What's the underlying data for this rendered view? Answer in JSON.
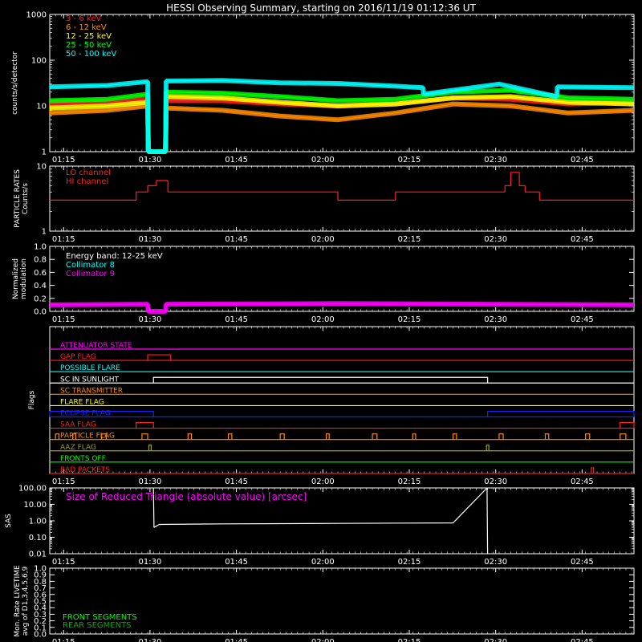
{
  "title": "HESSI Observing Summary, starting on 2016/11/19 01:12:36 UT",
  "time_axis": {
    "labels": [
      "01:15",
      "01:30",
      "01:45",
      "02:00",
      "02:15",
      "02:30",
      "02:45"
    ],
    "minutes": [
      2.4,
      17.4,
      32.4,
      47.4,
      62.4,
      77.4,
      92.4
    ],
    "range_min": [
      0,
      101.4
    ]
  },
  "colors": {
    "red": "#ff2020",
    "orange": "#ff8c00",
    "yellow": "#ffff00",
    "green": "#00ff00",
    "cyan": "#00ffff",
    "magenta": "#ff00ff",
    "white": "#ffffff",
    "blue": "#2020ff",
    "olive": "#a0a020",
    "dkgreen": "#00b000"
  },
  "chart_data": [
    {
      "type": "line",
      "ylabel": "counts/s/detector",
      "yscale": "log",
      "ylim": [
        1,
        1000
      ],
      "yticks": [
        "1",
        "10",
        "100",
        "1000"
      ],
      "yticks_values": [
        1,
        10,
        100,
        1000
      ],
      "legend_position": "top-left",
      "series": [
        {
          "name": "3 - 6 keV",
          "color": "#ff2020",
          "x": [
            0,
            10,
            17,
            17.1,
            20.1,
            20.2,
            30,
            40,
            50,
            60,
            70,
            80,
            90,
            101.4
          ],
          "y": [
            11,
            12,
            14,
            1,
            1,
            13,
            13,
            11,
            10,
            11,
            15,
            14,
            11,
            12
          ]
        },
        {
          "name": "6 - 12 keV",
          "color": "#ff8c00",
          "x": [
            0,
            10,
            17,
            17.1,
            20.1,
            20.2,
            30,
            40,
            50,
            60,
            70,
            80,
            90,
            101.4
          ],
          "y": [
            7,
            8,
            10,
            1,
            1,
            9,
            8,
            6,
            5,
            7,
            11,
            10,
            7,
            8
          ]
        },
        {
          "name": "12 - 25 keV",
          "color": "#ffff00",
          "x": [
            0,
            10,
            17,
            17.1,
            20.1,
            20.2,
            30,
            40,
            50,
            60,
            70,
            80,
            90,
            101.4
          ],
          "y": [
            9,
            10,
            12,
            1,
            1,
            16,
            15,
            12,
            10,
            11,
            15,
            16,
            12,
            11
          ]
        },
        {
          "name": "25 - 50 keV",
          "color": "#00ff00",
          "x": [
            0,
            10,
            17,
            17.1,
            20.1,
            20.2,
            30,
            40,
            50,
            60,
            70,
            80,
            90,
            101.4
          ],
          "y": [
            13,
            14,
            18,
            1,
            1,
            20,
            19,
            16,
            13,
            14,
            20,
            22,
            15,
            14
          ]
        },
        {
          "name": "50 - 100 keV",
          "color": "#00ffff",
          "x": [
            0,
            10,
            17,
            17.1,
            20.1,
            20.2,
            30,
            40,
            50,
            60,
            64.8,
            64.9,
            78,
            88,
            88.1,
            101.4
          ],
          "y": [
            26,
            28,
            34,
            1,
            1,
            35,
            36,
            32,
            31,
            27,
            25,
            18,
            30,
            16,
            26,
            25
          ]
        }
      ]
    },
    {
      "type": "line",
      "ylabel": "PARTICLE RATES\nCounts/s",
      "yscale": "log",
      "ylim": [
        1,
        10
      ],
      "yticks": [
        "1",
        "10"
      ],
      "yticks_values": [
        1,
        10
      ],
      "legend_position": "top-left",
      "series": [
        {
          "name": "LO channel",
          "color": "#ff2020",
          "x": [
            0,
            10,
            15,
            17,
            18.5,
            20.5,
            30,
            40,
            50,
            60,
            70,
            75,
            79,
            80,
            81.5,
            82.5,
            85,
            101.4
          ],
          "y": [
            3,
            3,
            4,
            5,
            6,
            4,
            4,
            4,
            3,
            4,
            4,
            4,
            5,
            8,
            5,
            4,
            3,
            3
          ]
        },
        {
          "name": "HI channel",
          "color": "#ff2020",
          "x": [],
          "y": []
        }
      ]
    },
    {
      "type": "line",
      "ylabel": "Normalized\nmodulation",
      "ylim": [
        0,
        1
      ],
      "yticks": [
        "0.0",
        "0.2",
        "0.4",
        "0.6",
        "0.8",
        "1.0"
      ],
      "yticks_values": [
        0,
        0.2,
        0.4,
        0.6,
        0.8,
        1.0
      ],
      "legend_position": "top-left",
      "annotation": "Energy band: 12-25 keV",
      "series": [
        {
          "name": "Collimator 8",
          "color": "#00ffff",
          "x": [],
          "y": []
        },
        {
          "name": "Collimator 9",
          "color": "#ff00ff",
          "x": [
            0,
            17,
            17.1,
            20.1,
            20.2,
            50,
            101.4
          ],
          "y": [
            0.1,
            0.11,
            0.0,
            0.0,
            0.11,
            0.12,
            0.1
          ]
        }
      ]
    },
    {
      "type": "line",
      "ylabel": "Flags",
      "flags": [
        {
          "name": "ATTENUATOR STATE",
          "color": "#ff00ff",
          "segments": []
        },
        {
          "name": "GAP FLAG",
          "color": "#ff2020",
          "segments": [
            [
              17,
              21
            ]
          ]
        },
        {
          "name": "POSSIBLE FLARE",
          "color": "#00ffff",
          "segments": []
        },
        {
          "name": "SC IN SUNLIGHT",
          "color": "#ffffff",
          "segments": [
            [
              18,
              76
            ]
          ]
        },
        {
          "name": "SC TRANSMITTER",
          "color": "#ff8c00",
          "segments": []
        },
        {
          "name": "FLARE FLAG",
          "color": "#ffff00",
          "segments": []
        },
        {
          "name": "ECLIPSE FLAG",
          "color": "#2020ff",
          "segments": [
            [
              0,
              18
            ],
            [
              76,
              101.4
            ]
          ]
        },
        {
          "name": "SAA FLAG",
          "color": "#ff2020",
          "segments": [
            [
              15,
              18
            ],
            [
              99,
              101.4
            ]
          ]
        },
        {
          "name": "PARTICLE FLAG",
          "color": "#ff8c00",
          "segments": [
            [
              1,
              1.6
            ],
            [
              4,
              4.5
            ],
            [
              9,
              9.8
            ],
            [
              16,
              17
            ],
            [
              24,
              24.6
            ],
            [
              31,
              31.6
            ],
            [
              40,
              40.7
            ],
            [
              48,
              48.5
            ],
            [
              56,
              56.8
            ],
            [
              63,
              63.5
            ],
            [
              70,
              70.6
            ],
            [
              78,
              78.7
            ],
            [
              86,
              86.6
            ],
            [
              93,
              93.7
            ],
            [
              99,
              100
            ]
          ]
        },
        {
          "name": "AAZ FLAG",
          "color": "#a0a020",
          "segments": [
            [
              17.2,
              17.6
            ],
            [
              75.8,
              76.2
            ]
          ]
        },
        {
          "name": "FRONTS OFF",
          "color": "#00ff00",
          "segments": []
        },
        {
          "name": "BAD PACKETS",
          "color": "#ff2020",
          "segments": [
            [
              94,
              94.4
            ]
          ]
        }
      ]
    },
    {
      "type": "line",
      "ylabel": "SAS",
      "yscale": "log",
      "ylim": [
        0.01,
        100
      ],
      "yticks": [
        "0.01",
        "0.10",
        "1.00",
        "10.00",
        "100.00"
      ],
      "yticks_values": [
        0.01,
        0.1,
        1,
        10,
        100
      ],
      "annotation": "Size of Reduced Triangle (absolute value) [arcsec]",
      "series": [
        {
          "name": "",
          "color": "#ffffff",
          "x": [
            18,
            18.1,
            19,
            30,
            50,
            70,
            75.9,
            76
          ],
          "y": [
            100,
            0.4,
            0.6,
            0.65,
            0.7,
            0.75,
            100,
            0.01
          ]
        }
      ]
    },
    {
      "type": "line",
      "ylabel": "Mon. Rate LIVETIME\navg of D1,3,4,5,6,9",
      "ylim": [
        0,
        1
      ],
      "yticks": [
        "0.0",
        "0.1",
        "0.2",
        "0.3",
        "0.4",
        "0.5",
        "0.6",
        "0.7",
        "0.8",
        "0.9",
        "1.0"
      ],
      "yticks_values": [
        0,
        0.1,
        0.2,
        0.3,
        0.4,
        0.5,
        0.6,
        0.7,
        0.8,
        0.9,
        1.0
      ],
      "legend_position": "bottom-left",
      "series": [
        {
          "name": "FRONT SEGMENTS",
          "color": "#00ff00",
          "x": [],
          "y": []
        },
        {
          "name": "REAR SEGMENTS",
          "color": "#00b000",
          "x": [],
          "y": []
        }
      ]
    }
  ]
}
